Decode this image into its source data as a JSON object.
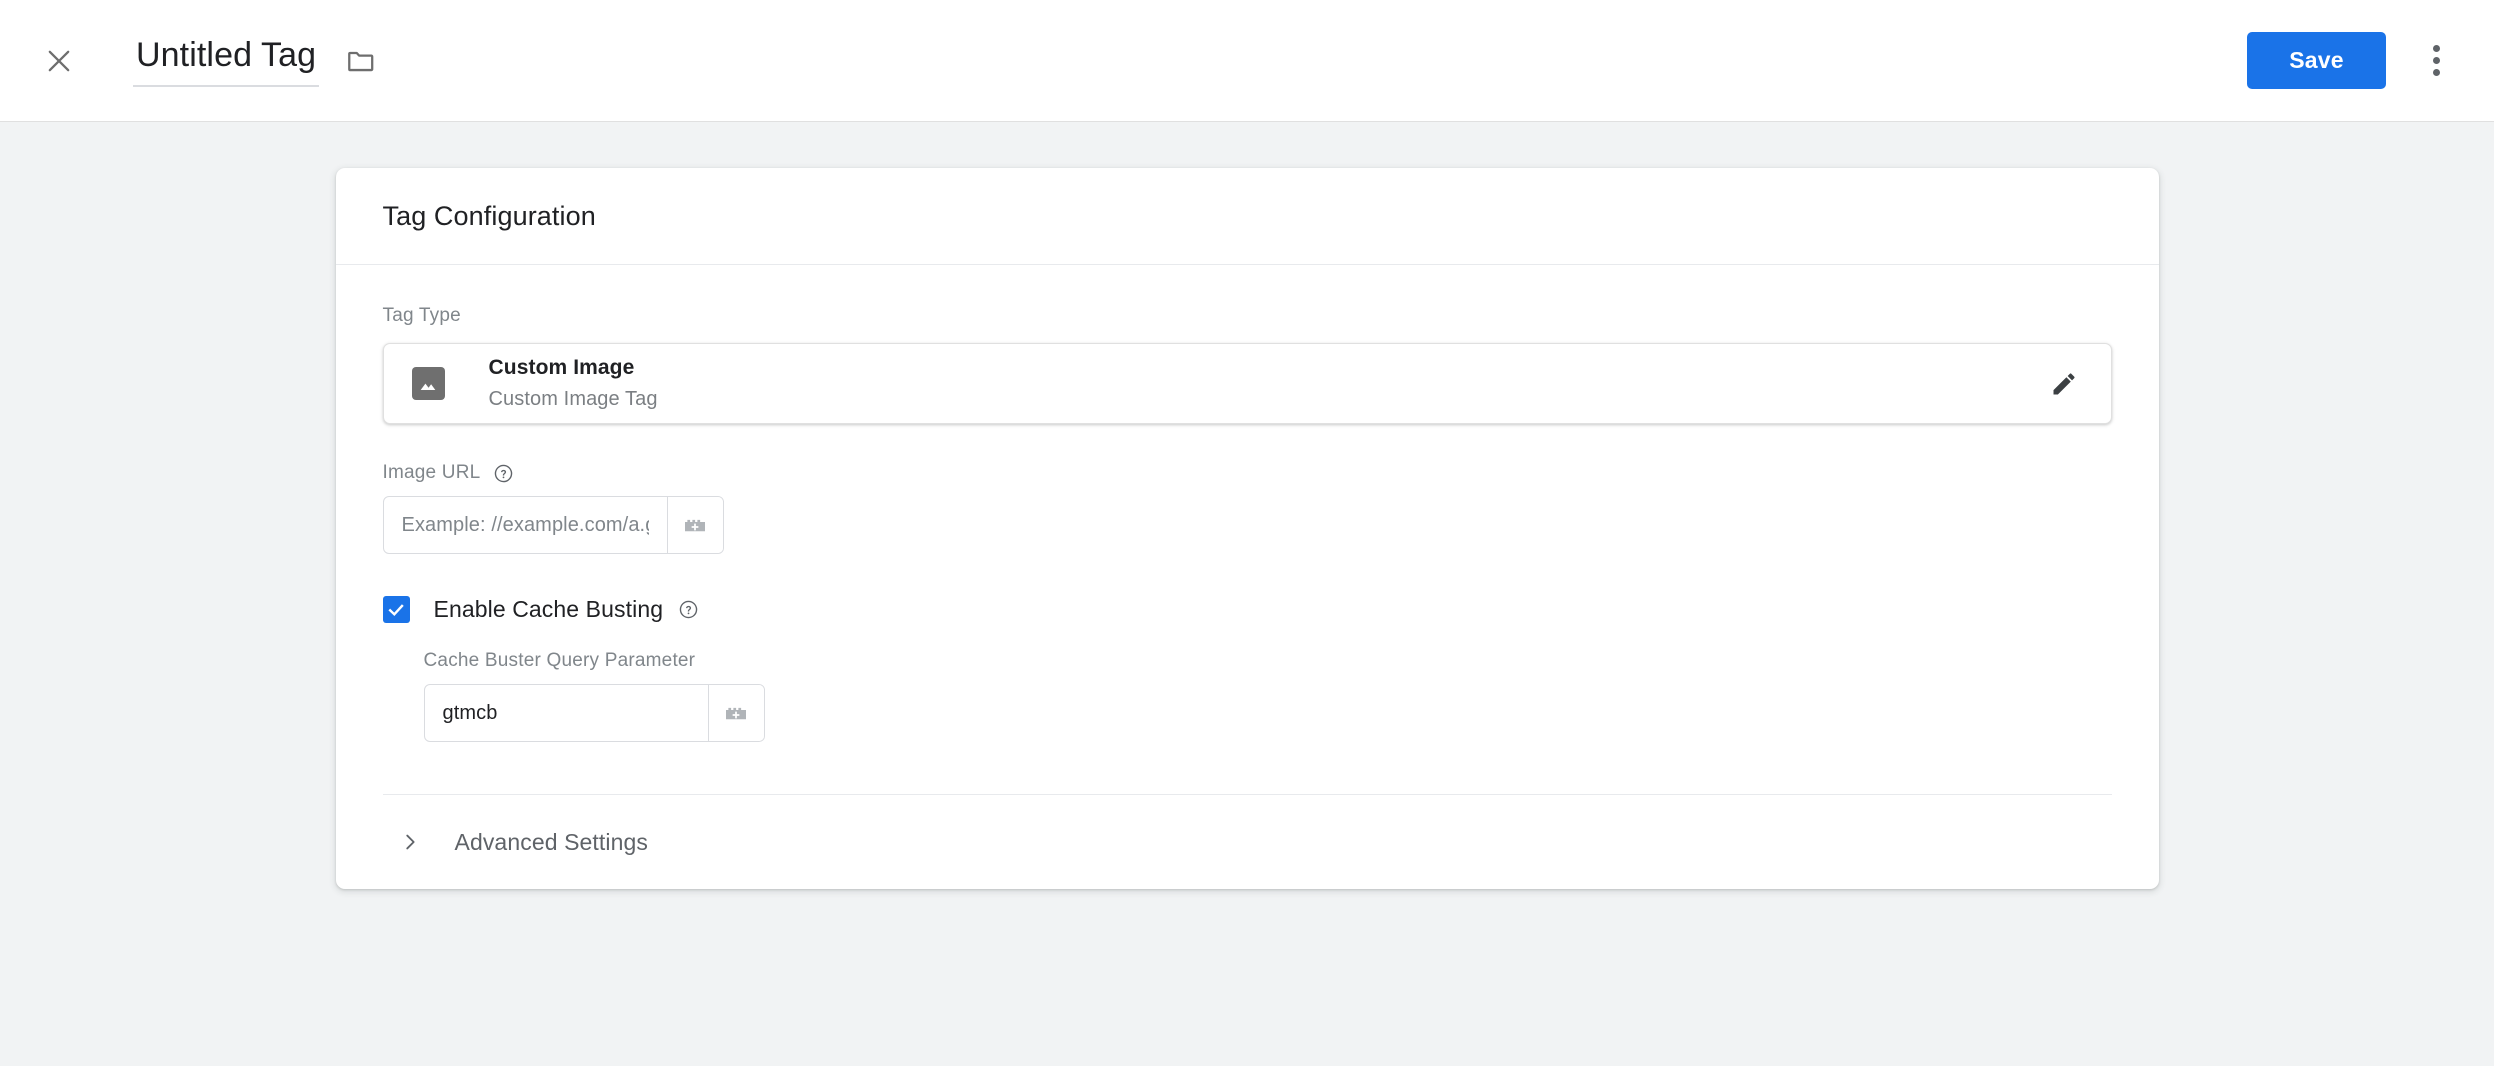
{
  "header": {
    "close_icon": "close-icon",
    "title_value": "Untitled Tag",
    "title_placeholder": "Untitled Tag",
    "folder_icon": "folder-icon",
    "save_label": "Save",
    "overflow_icon": "more-vert-icon",
    "accent_color": "#1a73e8"
  },
  "card": {
    "title": "Tag Configuration",
    "tag_type": {
      "label": "Tag Type",
      "icon": "image-icon",
      "name": "Custom Image",
      "description": "Custom Image Tag",
      "edit_icon": "pencil-icon"
    },
    "image_url": {
      "label": "Image URL",
      "help_icon": "help-circle-icon",
      "value": "",
      "placeholder": "Example: //example.com/a.gif",
      "variable_picker_icon": "variable-block-plus-icon"
    },
    "cache_busting": {
      "checked": true,
      "label": "Enable Cache Busting",
      "help_icon": "help-circle-icon",
      "checkbox_color": "#1a73e8"
    },
    "cache_buster_param": {
      "label": "Cache Buster Query Parameter",
      "value": "gtmcb",
      "placeholder": "",
      "variable_picker_icon": "variable-block-plus-icon"
    },
    "advanced_settings": {
      "label": "Advanced Settings",
      "expand_icon": "chevron-right-icon",
      "expanded": false
    }
  }
}
